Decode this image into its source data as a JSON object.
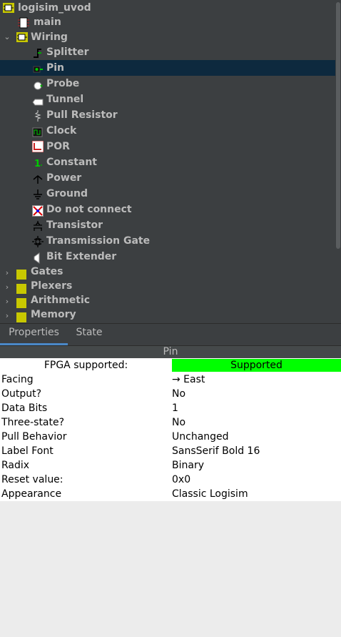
{
  "tree": {
    "project": "logisim_uvod",
    "circuit_main": "main",
    "folder_wiring": "Wiring",
    "wiring_items": [
      "Splitter",
      "Pin",
      "Probe",
      "Tunnel",
      "Pull Resistor",
      "Clock",
      "POR",
      "Constant",
      "Power",
      "Ground",
      "Do not connect",
      "Transistor",
      "Transmission Gate",
      "Bit Extender"
    ],
    "selected": "Pin",
    "collapsed_folders": [
      "Gates",
      "Plexers",
      "Arithmetic",
      "Memory"
    ]
  },
  "tabs": {
    "properties": "Properties",
    "state": "State"
  },
  "properties": {
    "title": "Pin",
    "fpga_label": "FPGA supported:",
    "fpga_value": "Supported",
    "rows": [
      {
        "name": "Facing",
        "value": "→ East"
      },
      {
        "name": "Output?",
        "value": "No"
      },
      {
        "name": "Data Bits",
        "value": "1"
      },
      {
        "name": "Three-state?",
        "value": "No"
      },
      {
        "name": "Pull Behavior",
        "value": "Unchanged"
      },
      {
        "name": "Label Font",
        "value": "SansSerif Bold 16"
      },
      {
        "name": "Radix",
        "value": "Binary"
      },
      {
        "name": "Reset value:",
        "value": "0x0"
      },
      {
        "name": "Appearance",
        "value": "Classic Logisim"
      }
    ]
  },
  "colors": {
    "tree_bg": "#3c3f41",
    "selection": "#0d293e",
    "tree_text": "#bbbbbb",
    "tab_accent": "#4a88c7",
    "supported": "#00ff00",
    "folder": "#c8c800"
  }
}
